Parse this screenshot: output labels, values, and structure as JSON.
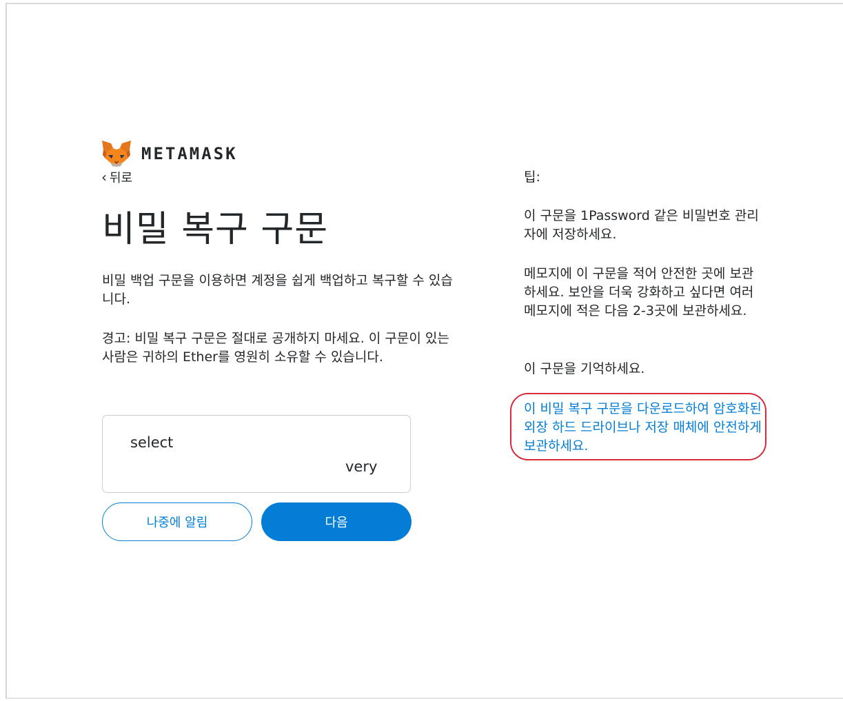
{
  "app": {
    "brand": "METAMASK",
    "logo_icon": "metamask-fox-icon",
    "accent_color": "#037dd6",
    "highlight_color": "#d8283a"
  },
  "nav": {
    "back_label": "뒤로",
    "back_icon": "chevron-left-icon"
  },
  "main": {
    "title": "비밀 복구 구문",
    "description": "비밀 백업 구문을 이용하면 계정을 쉽게 백업하고 복구할 수 있습니다.",
    "warning": "경고: 비밀 복구 구문은 절대로 공개하지 마세요. 이 구문이 있는 사람은 귀하의 Ether를 영원히 소유할 수 있습니다.",
    "phrase_words": [
      "select",
      "very"
    ]
  },
  "buttons": {
    "remind_later": "나중에 알림",
    "next": "다음"
  },
  "tips": {
    "title": "팁:",
    "items": [
      "이 구문을 1Password 같은 비밀번호 관리자에 저장하세요.",
      "메모지에 이 구문을 적어 안전한 곳에 보관하세요. 보안을 더욱 강화하고 싶다면 여러 메모지에 적은 다음 2-3곳에 보관하세요.",
      "이 구문을 기억하세요."
    ],
    "download_link": "이 비밀 복구 구문을 다운로드하여 암호화된 외장 하드 드라이브나 저장 매체에 안전하게 보관하세요."
  }
}
